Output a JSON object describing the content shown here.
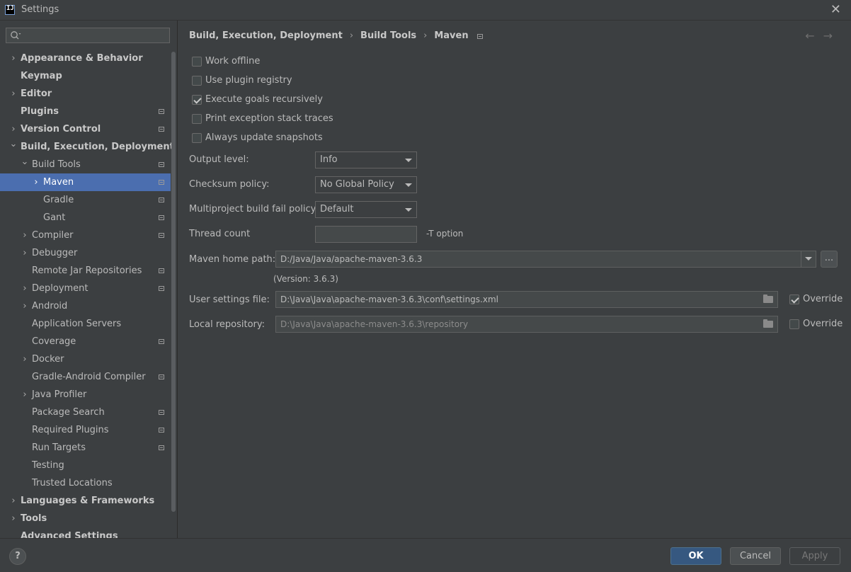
{
  "window": {
    "title": "Settings",
    "app_icon_text": "IJ"
  },
  "search": {
    "placeholder": ""
  },
  "sidebar": {
    "items": [
      {
        "label": "Appearance & Behavior",
        "level": 0,
        "expandable": true,
        "expanded": false,
        "bold": true,
        "project": false
      },
      {
        "label": "Keymap",
        "level": 0,
        "expandable": false,
        "bold": true,
        "project": false
      },
      {
        "label": "Editor",
        "level": 0,
        "expandable": true,
        "expanded": false,
        "bold": true,
        "project": false
      },
      {
        "label": "Plugins",
        "level": 0,
        "expandable": false,
        "bold": true,
        "project": true
      },
      {
        "label": "Version Control",
        "level": 0,
        "expandable": true,
        "expanded": false,
        "bold": true,
        "project": true
      },
      {
        "label": "Build, Execution, Deployment",
        "level": 0,
        "expandable": true,
        "expanded": true,
        "bold": true,
        "project": false
      },
      {
        "label": "Build Tools",
        "level": 1,
        "expandable": true,
        "expanded": true,
        "bold": false,
        "project": true
      },
      {
        "label": "Maven",
        "level": 2,
        "expandable": true,
        "expanded": false,
        "bold": false,
        "project": true,
        "selected": true
      },
      {
        "label": "Gradle",
        "level": 2,
        "expandable": false,
        "bold": false,
        "project": true
      },
      {
        "label": "Gant",
        "level": 2,
        "expandable": false,
        "bold": false,
        "project": true
      },
      {
        "label": "Compiler",
        "level": 1,
        "expandable": true,
        "expanded": false,
        "bold": false,
        "project": true
      },
      {
        "label": "Debugger",
        "level": 1,
        "expandable": true,
        "expanded": false,
        "bold": false,
        "project": false
      },
      {
        "label": "Remote Jar Repositories",
        "level": 1,
        "expandable": false,
        "bold": false,
        "project": true
      },
      {
        "label": "Deployment",
        "level": 1,
        "expandable": true,
        "expanded": false,
        "bold": false,
        "project": true
      },
      {
        "label": "Android",
        "level": 1,
        "expandable": true,
        "expanded": false,
        "bold": false,
        "project": false
      },
      {
        "label": "Application Servers",
        "level": 1,
        "expandable": false,
        "bold": false,
        "project": false
      },
      {
        "label": "Coverage",
        "level": 1,
        "expandable": false,
        "bold": false,
        "project": true
      },
      {
        "label": "Docker",
        "level": 1,
        "expandable": true,
        "expanded": false,
        "bold": false,
        "project": false
      },
      {
        "label": "Gradle-Android Compiler",
        "level": 1,
        "expandable": false,
        "bold": false,
        "project": true
      },
      {
        "label": "Java Profiler",
        "level": 1,
        "expandable": true,
        "expanded": false,
        "bold": false,
        "project": false
      },
      {
        "label": "Package Search",
        "level": 1,
        "expandable": false,
        "bold": false,
        "project": true
      },
      {
        "label": "Required Plugins",
        "level": 1,
        "expandable": false,
        "bold": false,
        "project": true
      },
      {
        "label": "Run Targets",
        "level": 1,
        "expandable": false,
        "bold": false,
        "project": true
      },
      {
        "label": "Testing",
        "level": 1,
        "expandable": false,
        "bold": false,
        "project": false
      },
      {
        "label": "Trusted Locations",
        "level": 1,
        "expandable": false,
        "bold": false,
        "project": false
      },
      {
        "label": "Languages & Frameworks",
        "level": 0,
        "expandable": true,
        "expanded": false,
        "bold": true,
        "project": false
      },
      {
        "label": "Tools",
        "level": 0,
        "expandable": true,
        "expanded": false,
        "bold": true,
        "project": false
      },
      {
        "label": "Advanced Settings",
        "level": 0,
        "expandable": false,
        "bold": true,
        "project": false
      }
    ]
  },
  "breadcrumb": {
    "parts": [
      "Build, Execution, Deployment",
      "Build Tools",
      "Maven"
    ]
  },
  "options": {
    "work_offline": {
      "label": "Work offline",
      "checked": false
    },
    "use_plugin_registry": {
      "label": "Use plugin registry",
      "checked": false
    },
    "execute_goals_recursively": {
      "label": "Execute goals recursively",
      "checked": true
    },
    "print_exception_stack_traces": {
      "label": "Print exception stack traces",
      "checked": false
    },
    "always_update_snapshots": {
      "label": "Always update snapshots",
      "checked": false
    }
  },
  "form": {
    "output_level": {
      "label": "Output level:",
      "value": "Info"
    },
    "checksum_policy": {
      "label": "Checksum policy:",
      "value": "No Global Policy"
    },
    "multiproject_policy": {
      "label": "Multiproject build fail policy:",
      "value": "Default"
    },
    "thread_count": {
      "label": "Thread count",
      "value": "",
      "suffix": "-T option"
    },
    "maven_home": {
      "label": "Maven home path:",
      "value": "D:/Java/Java/apache-maven-3.6.3",
      "browse_label": "...",
      "version": "(Version: 3.6.3)"
    },
    "user_settings": {
      "label": "User settings file:",
      "value": "D:\\Java\\Java\\apache-maven-3.6.3\\conf\\settings.xml",
      "override_label": "Override",
      "override_checked": true
    },
    "local_repository": {
      "label": "Local repository:",
      "value": "D:\\Java\\Java\\apache-maven-3.6.3\\repository",
      "override_label": "Override",
      "override_checked": false
    }
  },
  "footer": {
    "help_label": "?",
    "ok_label": "OK",
    "cancel_label": "Cancel",
    "apply_label": "Apply"
  },
  "colors": {
    "selection": "#4b6eaf",
    "background": "#3c3f41",
    "primary_button": "#365880"
  }
}
